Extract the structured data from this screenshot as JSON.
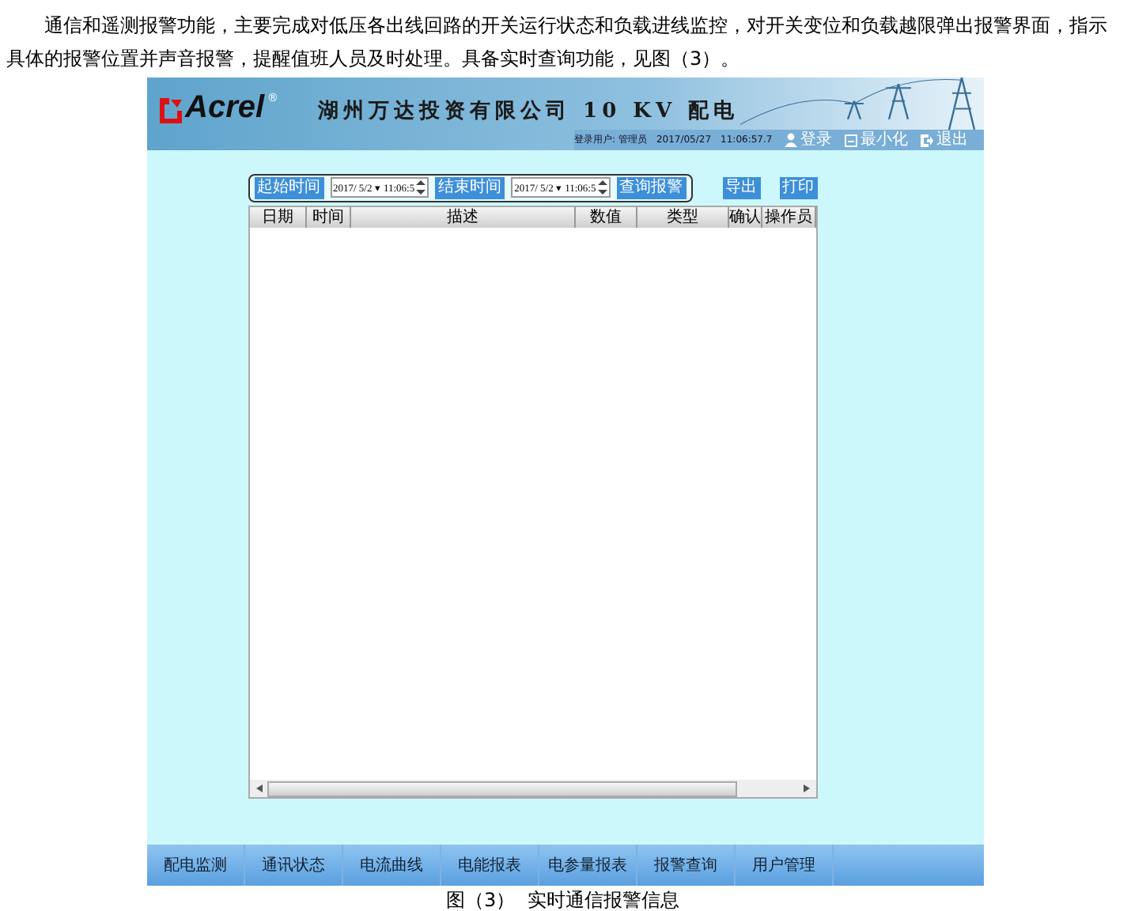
{
  "article": {
    "paragraph": "通信和遥测报警功能，主要完成对低压各出线回路的开关运行状态和负载进线监控，对开关变位和负载越限弹出报警界面，指示具体的报警位置并声音报警，提醒值班人员及时处理。具备实时查询功能，见图（3）。",
    "caption": "图（3）  实时通信报警信息"
  },
  "app": {
    "logo": "Acrel",
    "logo_mark": "®",
    "title": "湖州万达投资有限公司 10 KV 配电",
    "user": "登录用户: 管理员",
    "date": "2017/05/27",
    "time": "11:06:57.7",
    "header_buttons": [
      "登录",
      "最小化",
      "退出"
    ],
    "filter": {
      "start_button": "起始时间",
      "start_value": "2017/ 5/2 ▾ 11:06:5",
      "end_button": "结束时间",
      "end_value": "2017/ 5/2 ▾ 11:06:5",
      "query_button": "查询报警"
    },
    "actions": [
      "导出",
      "打印"
    ],
    "table": {
      "columns": [
        "日期",
        "时间",
        "描述",
        "数值",
        "类型",
        "确认",
        "操作员"
      ]
    },
    "nav": [
      {
        "label": "配电监测",
        "selected": false
      },
      {
        "label": "通讯状态",
        "selected": false
      },
      {
        "label": "电流曲线",
        "selected": false
      },
      {
        "label": "电能报表",
        "selected": false
      },
      {
        "label": "电参量报表",
        "selected": false
      },
      {
        "label": "报警查询",
        "selected": false
      },
      {
        "label": "用户管理",
        "selected": false
      }
    ]
  }
}
